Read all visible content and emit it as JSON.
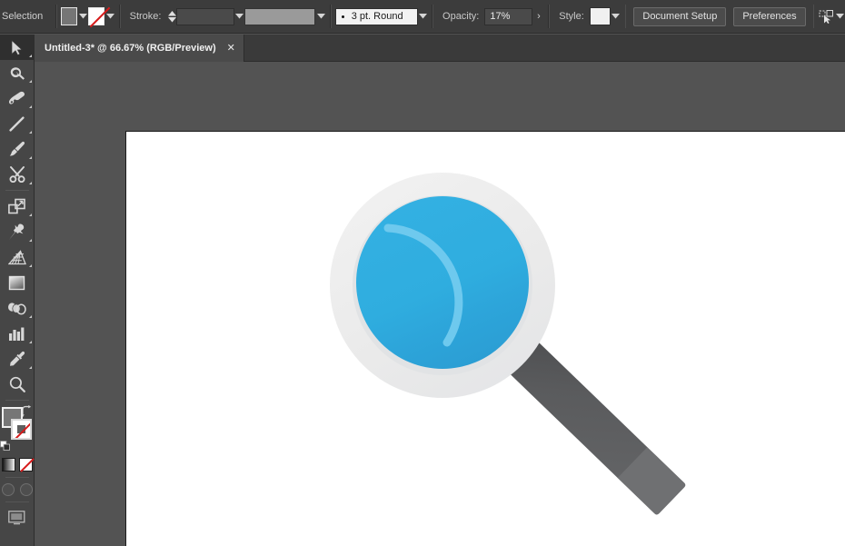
{
  "window": {
    "app": "Adobe Illustrator"
  },
  "control_bar": {
    "tool_label": "Selection",
    "fill_swatch": {
      "name": "fill-color",
      "color": "#767676"
    },
    "stroke_swatch": {
      "name": "stroke-none",
      "color": "none"
    },
    "stroke_label": "Stroke:",
    "stroke_weight": "",
    "stroke_profile": "",
    "brush_definition": "3 pt. Round",
    "opacity_label": "Opacity:",
    "opacity_value": "17%",
    "style_label": "Style:",
    "style_swatch_color": "#f0f0f0",
    "document_setup_label": "Document Setup",
    "preferences_label": "Preferences",
    "select_similar_icon": "select-similar-objects-icon"
  },
  "tab_bar": {
    "tabs": [
      {
        "title": "Untitled-3* @ 66.67% (RGB/Preview)",
        "close": "✕",
        "active": true
      }
    ]
  },
  "tools": {
    "items": [
      {
        "name": "selection-tool",
        "icon": "arrow-cursor-icon",
        "selected": true,
        "has_flyout": true
      },
      {
        "name": "direct-selection-tool",
        "icon": "lasso-icon",
        "selected": false,
        "has_flyout": true
      },
      {
        "name": "pen-tool",
        "icon": "pen-icon",
        "selected": false,
        "has_flyout": true
      },
      {
        "name": "line-segment-tool",
        "icon": "line-icon",
        "selected": false,
        "has_flyout": true
      },
      {
        "name": "paintbrush-tool",
        "icon": "paintbrush-icon",
        "selected": false,
        "has_flyout": true
      },
      {
        "name": "scissors-tool",
        "icon": "scissors-icon",
        "selected": false,
        "has_flyout": true
      },
      {
        "name": "free-transform-tool",
        "icon": "transform-icon",
        "selected": false,
        "has_flyout": true
      },
      {
        "name": "puppet-warp-tool",
        "icon": "pushpin-icon",
        "selected": false,
        "has_flyout": true
      },
      {
        "name": "perspective-grid-tool",
        "icon": "perspective-grid-icon",
        "selected": false,
        "has_flyout": true
      },
      {
        "name": "gradient-tool",
        "icon": "gradient-square-icon",
        "selected": false,
        "has_flyout": false
      },
      {
        "name": "blend-tool",
        "icon": "blend-icon",
        "selected": false,
        "has_flyout": true
      },
      {
        "name": "column-graph-tool",
        "icon": "bar-chart-icon",
        "selected": false,
        "has_flyout": true
      },
      {
        "name": "eyedropper-tool",
        "icon": "eyedropper-icon",
        "selected": false,
        "has_flyout": true
      },
      {
        "name": "zoom-tool",
        "icon": "magnifier-icon",
        "selected": false,
        "has_flyout": false
      }
    ],
    "fill_color": "#767676",
    "stroke_color": "none",
    "swap_icon": "swap-fill-stroke-icon",
    "default_icon": "default-fill-stroke-icon",
    "gradient_icon": "gradient-icon",
    "none_icon": "none-icon",
    "screen_mode_icon": "screen-mode-icon"
  },
  "canvas": {
    "artwork_name": "magnifying-glass-illustration",
    "zoom": "66.67%",
    "colors": {
      "ring_outer": "#ebebeb",
      "ring_inner_shadow": "#e0e2e4",
      "lens_light": "#31aee0",
      "lens_dark": "#2b9fd4",
      "lens_highlight": "#6ec9ee",
      "handle": "#58585a",
      "handle_tip": "#6f7072"
    }
  }
}
